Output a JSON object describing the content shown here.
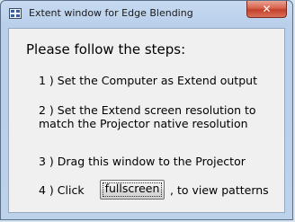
{
  "window": {
    "title": "Extent window for Edge Blending",
    "close_label": "x",
    "app_icon": "wrench-app-icon"
  },
  "content": {
    "heading": "Please follow the steps:",
    "step1": "1 ) Set the Computer as Extend output",
    "step2_line1": "2 ) Set the Extend screen resolution to",
    "step2_line2": "match the Projector native resolution",
    "step3": "3 ) Drag this window to the Projector",
    "step4_prefix": "4 ) Click",
    "fullscreen_button": "fullscreen",
    "step4_suffix": ", to view patterns"
  }
}
